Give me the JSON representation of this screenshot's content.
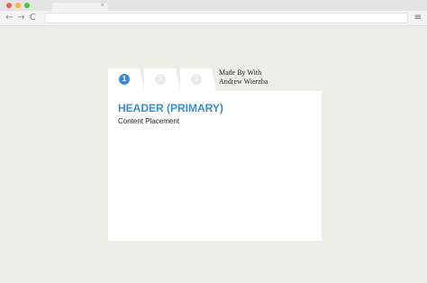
{
  "browser": {
    "tab_close": "×",
    "back_icon": "←",
    "forward_icon": "→",
    "reload_icon": "C",
    "menu_icon": "≡"
  },
  "steps": [
    {
      "number": "1",
      "state": "active"
    },
    {
      "number": "2",
      "state": "inactive"
    },
    {
      "number": "3",
      "state": "inactive"
    }
  ],
  "credit": {
    "line1": "Made By With",
    "line2": "Andrew Wierzba"
  },
  "card": {
    "header": "HEADER (PRIMARY)",
    "body": "Content Placement"
  },
  "colors": {
    "accent": "#3b8bd0",
    "background": "#eeeee9"
  }
}
